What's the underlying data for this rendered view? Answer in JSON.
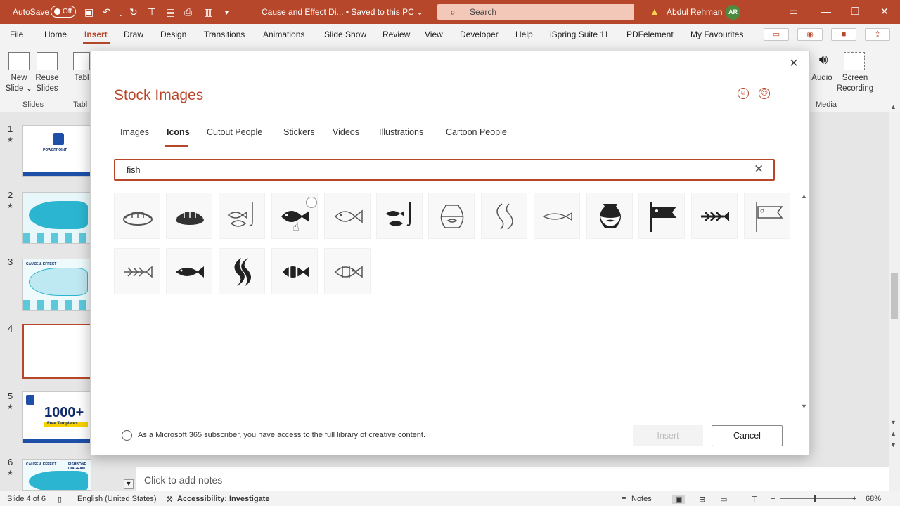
{
  "titlebar": {
    "autosave": "AutoSave",
    "autosave_state": "Off",
    "doc_title": "Cause and Effect Di...  •  Saved to this PC ⌄",
    "search_placeholder": "Search",
    "user_name": "Abdul Rehman",
    "user_initials": "AR"
  },
  "menu": [
    "File",
    "Home",
    "Insert",
    "Draw",
    "Design",
    "Transitions",
    "Animations",
    "Slide Show",
    "Review",
    "View",
    "Developer",
    "Help",
    "iSpring Suite 11",
    "PDFelement",
    "My Favourites"
  ],
  "ribbon": {
    "new_slide": "New\nSlide ⌄",
    "reuse_slides": "Reuse\nSlides",
    "table": "Tabl",
    "slides_group": "Slides",
    "table_group": "Tabl",
    "audio": "Audio",
    "screen_recording": "Screen\nRecording",
    "media_group": "Media"
  },
  "thumbnails": {
    "numbers": [
      "1",
      "2",
      "3",
      "4",
      "5",
      "6"
    ],
    "templates_text": "1000+",
    "templates_sub": "Free Templates",
    "cause_effect": "CAUSE & EFFECT",
    "fishbone": "FISHBONE DIAGRAM",
    "powerpoint": "POWERPOINT"
  },
  "notes_placeholder": "Click to add notes",
  "status": {
    "slide": "Slide 4 of 6",
    "language": "English (United States)",
    "accessibility": "Accessibility: Investigate",
    "notes": "Notes",
    "zoom": "68%"
  },
  "dialog": {
    "title": "Stock Images",
    "tabs": [
      "Images",
      "Icons",
      "Cutout People",
      "Stickers",
      "Videos",
      "Illustrations",
      "Cartoon People"
    ],
    "active_tab": "Icons",
    "search_value": "fish",
    "info_text": "As a Microsoft 365 subscriber, you have access to the full library of creative content.",
    "insert_label": "Insert",
    "cancel_label": "Cancel",
    "icons_row1": [
      "sushi-outline-icon",
      "sushi-filled-icon",
      "fish-hook-outline-icon",
      "fish-filled-icon",
      "fish-outline-icon",
      "fish-hook-filled-icon",
      "fishbowl-outline-icon",
      "koi-outline-icon",
      "fish-thin-outline-icon",
      "fishbowl-filled-icon",
      "koinobori-filled-icon",
      "fishbone-filled-icon",
      "koinobori-outline-icon"
    ],
    "icons_row2": [
      "fishbone-outline-icon",
      "fish-solid-icon",
      "koi-pair-filled-icon",
      "clownfish-filled-icon",
      "clownfish-outline-icon"
    ]
  },
  "colors": {
    "accent": "#b7472a",
    "title_bar": "#b7472a"
  }
}
